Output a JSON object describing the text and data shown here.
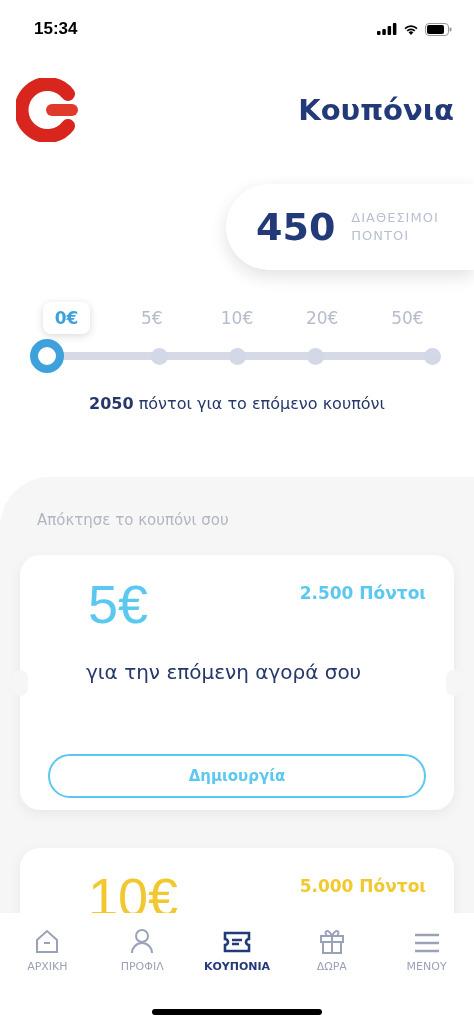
{
  "status_bar": {
    "time": "15:34"
  },
  "header": {
    "title": "Κουπόνια"
  },
  "points": {
    "value": "450",
    "label_line_1": "ΔΙΑΘΕΣΙΜΟΙ",
    "label_line_2": "ΠΟΝΤΟΙ"
  },
  "slider": {
    "stops": [
      {
        "label": "0€",
        "selected": true
      },
      {
        "label": "5€",
        "selected": false
      },
      {
        "label": "10€",
        "selected": false
      },
      {
        "label": "20€",
        "selected": false
      },
      {
        "label": "50€",
        "selected": false
      }
    ],
    "next_text": "**2050** πόντοι για το επόμενο κουπόνι"
  },
  "section_title": "Απόκτησε το κουπόνι σου",
  "coupons": [
    {
      "amount": "5€",
      "points": "2.500 Πόντοι",
      "color": "#5bc8f0",
      "description": "για την επόμενη αγορά σου",
      "button": "Δημιουργία"
    },
    {
      "amount": "10€",
      "points": "5.000 Πόντοι",
      "color": "#f2c830"
    }
  ],
  "tab_bar": [
    {
      "label": "ΑΡΧΙΚΗ",
      "kind": "home",
      "selected": false
    },
    {
      "label": "ΠΡΟΦΙΛ",
      "kind": "profile",
      "selected": false
    },
    {
      "label": "ΚΟΥΠΟΝΙΑ",
      "kind": "coupon",
      "selected": true
    },
    {
      "label": "ΔΩΡΑ",
      "kind": "gift",
      "selected": false
    },
    {
      "label": "ΜΕΝΟΥ",
      "kind": "menu",
      "selected": false
    }
  ]
}
